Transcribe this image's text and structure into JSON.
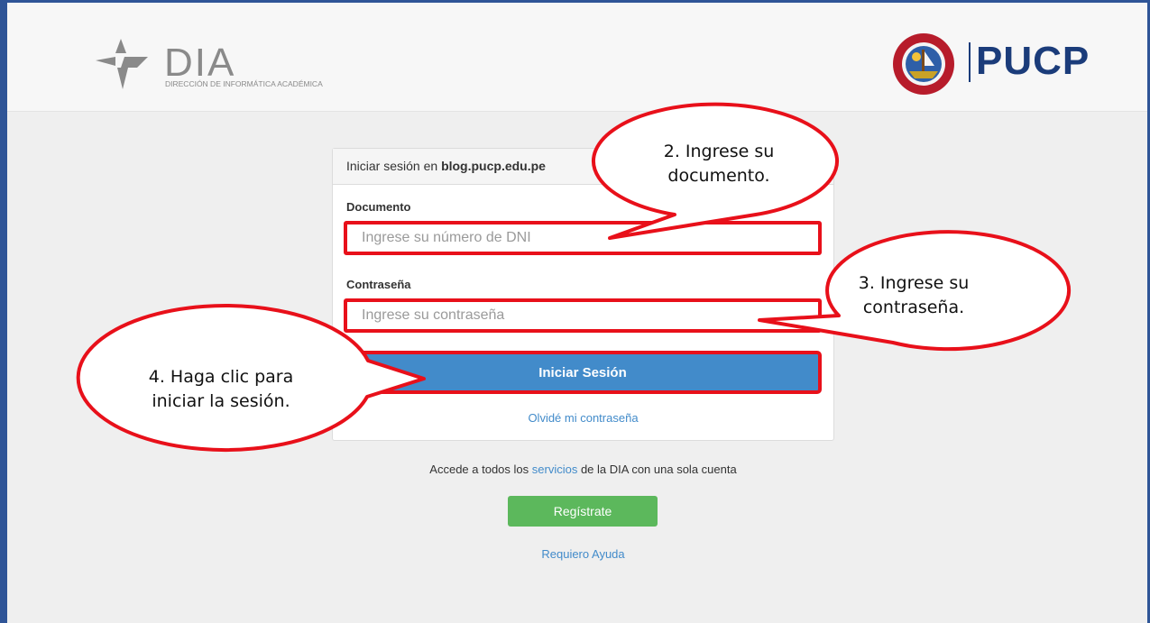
{
  "header": {
    "dia_logo_text": "DIA",
    "dia_subtitle": "DIRECCIÓN DE INFORMÁTICA ACADÉMICA",
    "pucp_logo_text": "PUCP",
    "seal_text": "ET LUX IN TENEBRIS LUCET"
  },
  "login": {
    "title_prefix": "Iniciar sesión en ",
    "title_site": "blog.pucp.edu.pe",
    "document_label": "Documento",
    "document_placeholder": "Ingrese su número de DNI",
    "password_label": "Contraseña",
    "password_placeholder": "Ingrese su contraseña",
    "submit_label": "Iniciar Sesión",
    "forgot_label": "Olvidé mi contraseña"
  },
  "footer": {
    "services_before": "Accede a todos los ",
    "services_link": "servicios",
    "services_after": " de la DIA con una sola cuenta",
    "register_label": "Regístrate",
    "help_label": "Requiero Ayuda"
  },
  "callouts": {
    "step2_line1": "2. Ingrese su",
    "step2_line2": "documento.",
    "step3_line1": "3. Ingrese su",
    "step3_line2": "contraseña.",
    "step4_line1": "4. Haga clic para",
    "step4_line2": "iniciar la sesión."
  },
  "colors": {
    "primary": "#428bca",
    "success": "#5cb85c",
    "highlight": "#e8101a",
    "frame": "#2f5597"
  }
}
